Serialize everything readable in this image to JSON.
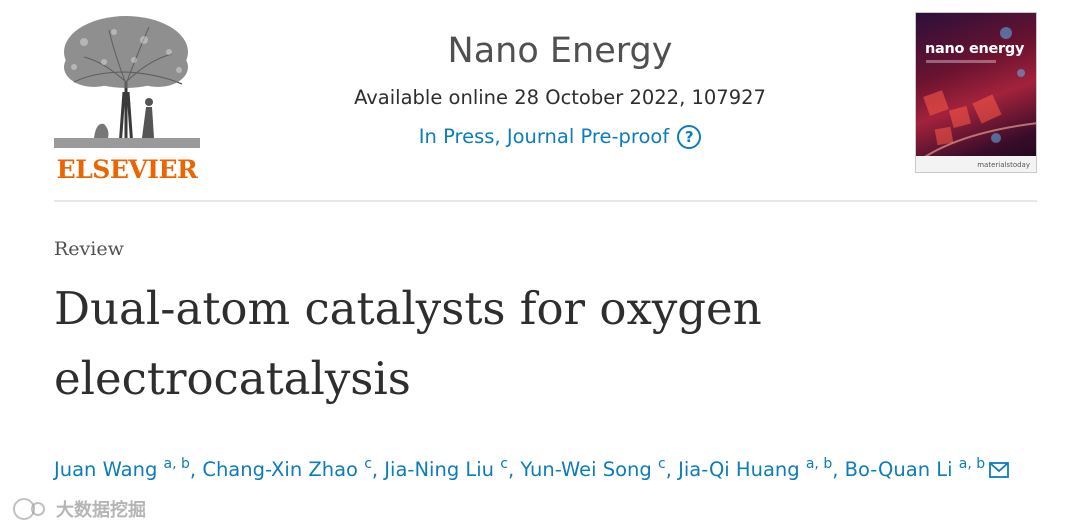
{
  "publisher": {
    "wordmark": "ELSEVIER",
    "color": "#eb6500"
  },
  "journal": {
    "name": "Nano Energy",
    "availability": "Available online 28 October 2022, 107927",
    "status_link": "In Press, Journal Pre-proof",
    "help_icon": "?",
    "link_color": "#0c7dbb"
  },
  "cover": {
    "title": "nano energy",
    "brand": "materialstoday"
  },
  "article": {
    "type": "Review",
    "title": "Dual-atom catalysts for oxygen electrocatalysis"
  },
  "authors": [
    {
      "name": "Juan Wang",
      "aff": "a, b",
      "sep": ", "
    },
    {
      "name": "Chang-Xin Zhao",
      "aff": "c",
      "sep": ", "
    },
    {
      "name": "Jia-Ning Liu",
      "aff": "c",
      "sep": ", "
    },
    {
      "name": "Yun-Wei Song",
      "aff": "c",
      "sep": ", "
    },
    {
      "name": "Jia-Qi Huang",
      "aff": "a, b",
      "sep": ", "
    },
    {
      "name": "Bo-Quan Li",
      "aff": "a, b",
      "sep": ""
    }
  ],
  "watermark": "大数据挖掘"
}
